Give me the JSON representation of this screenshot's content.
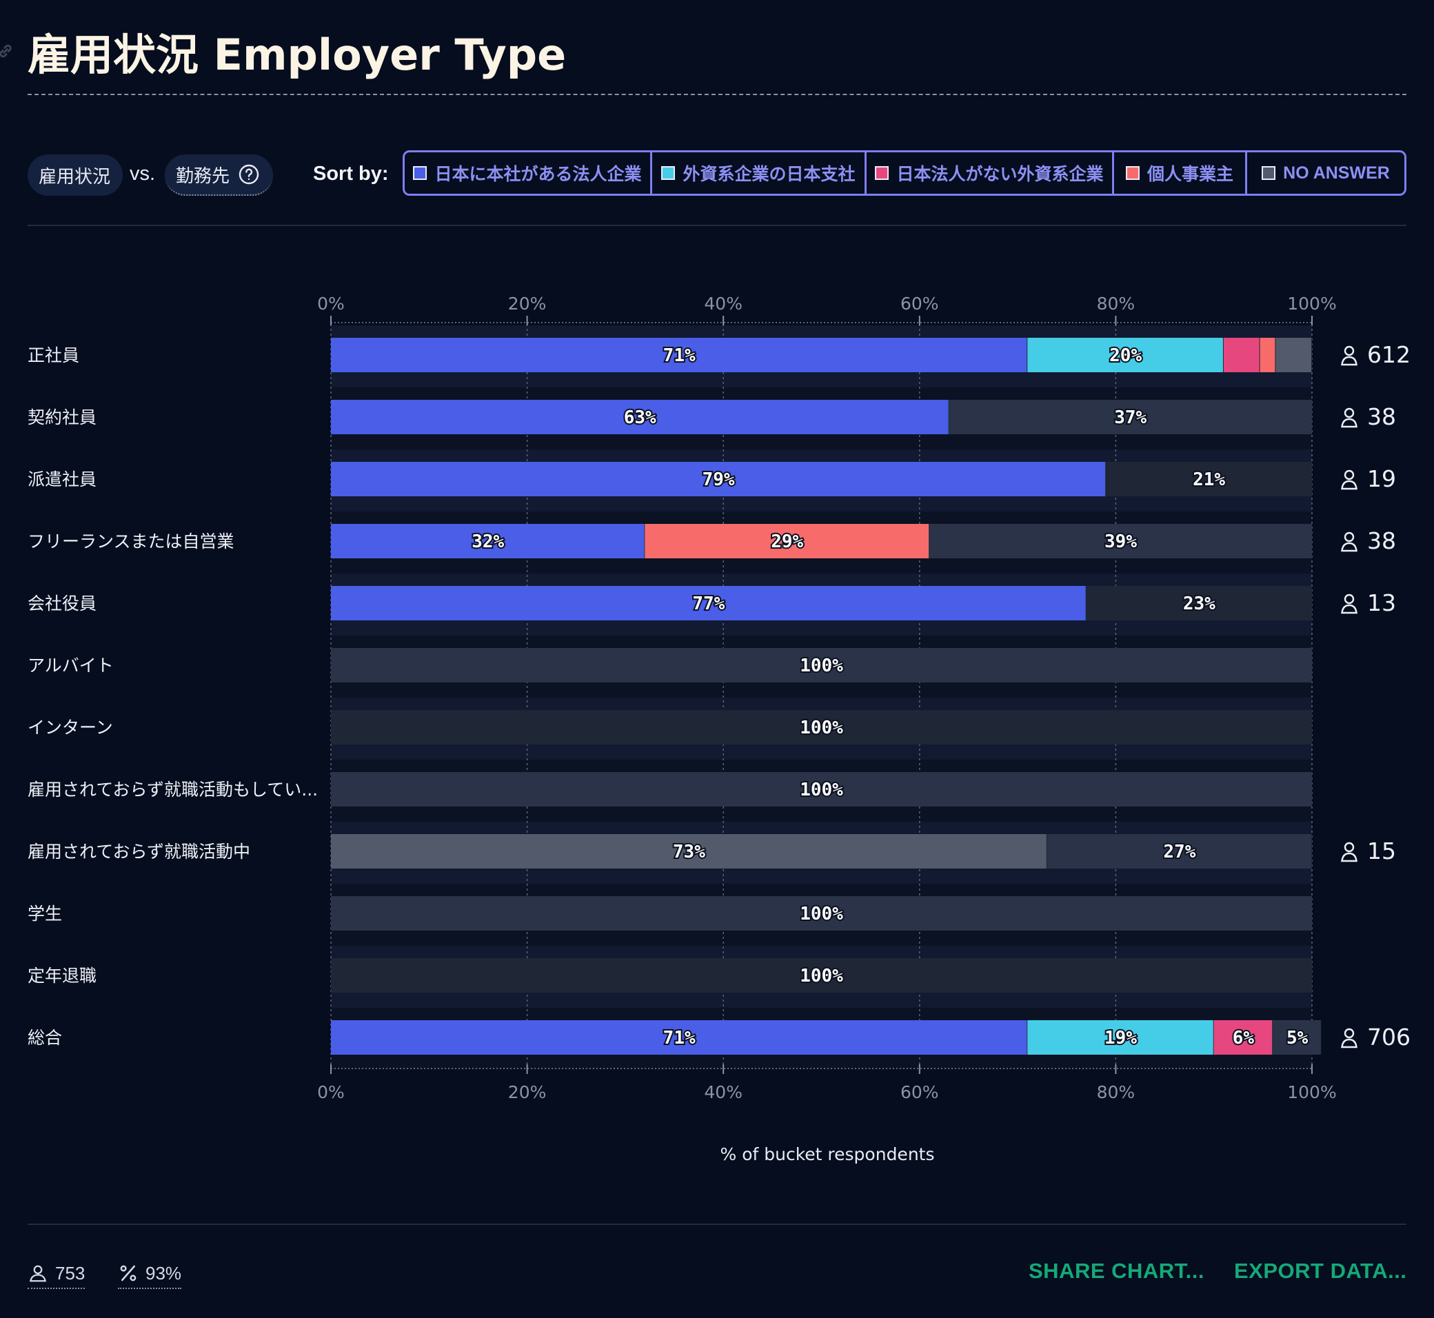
{
  "header": {
    "title": "雇用状況 Employer Type"
  },
  "controls": {
    "question_a": "雇用状況",
    "vs_label": "vs.",
    "question_b": "勤務先",
    "sort_label": "Sort by:",
    "sort_options": [
      {
        "label": "日本に本社がある法人企業",
        "color": "#4a5ee8"
      },
      {
        "label": "外資系企業の日本支社",
        "color": "#45cde8"
      },
      {
        "label": "日本法人がない外資系企業",
        "color": "#e7477f"
      },
      {
        "label": "個人事業主",
        "color": "#f86b6b"
      },
      {
        "label": "NO ANSWER",
        "color": "#525a6c"
      }
    ]
  },
  "chart_data": {
    "type": "bar",
    "orientation": "horizontal",
    "stacked": true,
    "normalized": true,
    "xlim": [
      0,
      100
    ],
    "xticks": [
      "0%",
      "20%",
      "40%",
      "60%",
      "80%",
      "100%"
    ],
    "xlabel": "% of bucket respondents",
    "grid": true,
    "legend": "top",
    "series": [
      {
        "name": "日本に本社がある法人企業",
        "color": "#4a5ee8"
      },
      {
        "name": "外資系企業の日本支社",
        "color": "#45cde8"
      },
      {
        "name": "日本法人がない外資系企業",
        "color": "#e7477f"
      },
      {
        "name": "個人事業主",
        "color": "#f86b6b"
      },
      {
        "name": "NO ANSWER",
        "color": "#525a6c"
      }
    ],
    "categories": [
      {
        "label": "正社員",
        "count": "612",
        "values": [
          71,
          20,
          3.7,
          1.6,
          3.7
        ],
        "labels": [
          "71%",
          "20%",
          "",
          "",
          ""
        ]
      },
      {
        "label": "契約社員",
        "count": "38",
        "values": [
          63,
          0,
          0,
          0,
          37
        ],
        "labels": [
          "63%",
          "",
          "",
          "",
          "37%"
        ]
      },
      {
        "label": "派遣社員",
        "count": "19",
        "values": [
          79,
          0,
          0,
          0,
          21
        ],
        "labels": [
          "79%",
          "",
          "",
          "",
          "21%"
        ]
      },
      {
        "label": "フリーランスまたは自営業",
        "count": "38",
        "values": [
          32,
          0,
          0,
          29,
          39
        ],
        "labels": [
          "32%",
          "",
          "",
          "29%",
          "39%"
        ]
      },
      {
        "label": "会社役員",
        "count": "13",
        "values": [
          77,
          0,
          0,
          0,
          23
        ],
        "labels": [
          "77%",
          "",
          "",
          "",
          "23%"
        ]
      },
      {
        "label": "アルバイト",
        "count": "",
        "values": [
          0,
          0,
          0,
          0,
          100
        ],
        "labels": [
          "",
          "",
          "",
          "",
          "100%"
        ]
      },
      {
        "label": "インターン",
        "count": "",
        "values": [
          0,
          0,
          0,
          0,
          100
        ],
        "labels": [
          "",
          "",
          "",
          "",
          "100%"
        ]
      },
      {
        "label": "雇用されておらず就職活動もしてい...",
        "count": "",
        "values": [
          0,
          0,
          0,
          0,
          100
        ],
        "labels": [
          "",
          "",
          "",
          "",
          "100%"
        ]
      },
      {
        "label": "雇用されておらず就職活動中",
        "count": "15",
        "values": [
          0,
          0,
          0,
          0,
          100
        ],
        "labels": [
          "",
          "",
          "",
          "",
          ""
        ],
        "override": [
          {
            "value": 73,
            "label": "73%",
            "color": "#525a6c"
          },
          {
            "value": 27,
            "label": "27%",
            "color": "#2a3347"
          }
        ]
      },
      {
        "label": "学生",
        "count": "",
        "values": [
          0,
          0,
          0,
          0,
          100
        ],
        "labels": [
          "",
          "",
          "",
          "",
          "100%"
        ]
      },
      {
        "label": "定年退職",
        "count": "",
        "values": [
          0,
          0,
          0,
          0,
          100
        ],
        "labels": [
          "",
          "",
          "",
          "",
          "100%"
        ]
      },
      {
        "label": "総合",
        "count": "706",
        "values": [
          71,
          19,
          6,
          0,
          5
        ],
        "labels": [
          "71%",
          "19%",
          "6%",
          "",
          "5%"
        ]
      }
    ]
  },
  "footer": {
    "respondents": "753",
    "completion": "93%",
    "share_label": "SHARE CHART...",
    "export_label": "EXPORT DATA..."
  }
}
